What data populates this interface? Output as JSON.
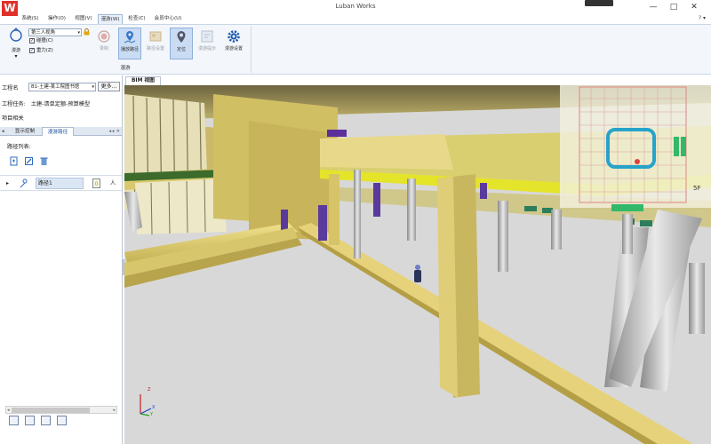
{
  "window": {
    "title": "Luban Works",
    "logo_letter": "W",
    "minimize": "—",
    "maximize": "□",
    "close": "✕"
  },
  "menu": {
    "tabs": [
      "系统(S)",
      "操作(O)",
      "视图(V)",
      "漫游(W)",
      "检查(C)",
      "会员中心(U)"
    ],
    "active_index": 3,
    "right_icons": "?  ▾"
  },
  "ribbon": {
    "tour_label": "漫游",
    "view_mode": "第三人视角",
    "checkboxes": [
      {
        "label": "碰撞(C)",
        "checked": true
      },
      {
        "label": "重力(Z)",
        "checked": true
      }
    ],
    "buttons": [
      {
        "label": "录制",
        "enabled": false,
        "selected": false
      },
      {
        "label": "播放路径",
        "enabled": true,
        "selected": true
      },
      {
        "label": "路径设置",
        "enabled": false,
        "selected": false
      },
      {
        "label": "定位",
        "enabled": true,
        "selected": true
      },
      {
        "label": "漫游提示",
        "enabled": false,
        "selected": false
      },
      {
        "label": "漫游设置",
        "enabled": true,
        "selected": false
      }
    ],
    "group_label": "漫游"
  },
  "left_panel": {
    "project_label": "工程名",
    "project_value": "B1-土建-某工院图书馆",
    "more_button": "更多...",
    "task_label": "工程任务:",
    "task_value": "土建-清单定额-预算模型",
    "related_label": "项目相关",
    "subtabs": [
      "显示控制",
      "漫游路径"
    ],
    "active_subtab": 1,
    "subtab_nav": "◂ ▸ ✕",
    "path_list_label": "路径列表:",
    "paths": [
      {
        "name": "路径1",
        "type": "人"
      }
    ]
  },
  "bim": {
    "tab_label": "BIM 视图",
    "floor_label": "5F",
    "axis_z": "Z",
    "axis_x": "X",
    "axis_y": "Y"
  },
  "colors": {
    "accent": "#1a4f9c",
    "beam": "#d8c56a",
    "beam_bright": "#e8e82a",
    "floor": "#d9d9d9",
    "window_green": "#2e7d5b",
    "minimap_path": "#27a3c9",
    "logo_red": "#e0302a"
  }
}
